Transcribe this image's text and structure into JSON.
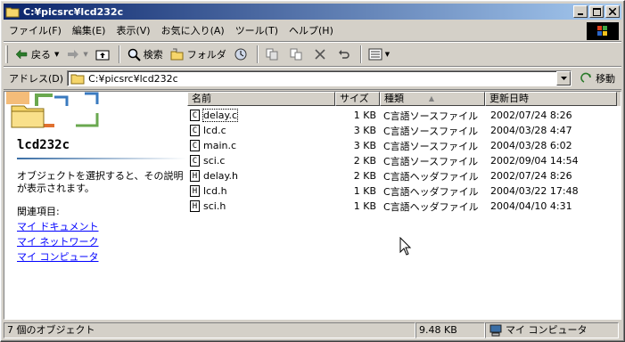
{
  "window": {
    "title": "C:¥picsrc¥lcd232c",
    "minimize": "_",
    "maximize": "□",
    "close": "✕"
  },
  "menu": [
    "ファイル(F)",
    "編集(E)",
    "表示(V)",
    "お気に入り(A)",
    "ツール(T)",
    "ヘルプ(H)"
  ],
  "toolbar": {
    "back": "戻る",
    "search": "検索",
    "folders": "フォルダ"
  },
  "address": {
    "label": "アドレス(D)",
    "path": "C:¥picsrc¥lcd232c",
    "go": "移動"
  },
  "leftpane": {
    "folder_name": "lcd232c",
    "description": "オブジェクトを選択すると、その説明が表示されます。",
    "related_label": "関連項目:",
    "links": [
      "マイ ドキュメント",
      "マイ ネットワーク",
      "マイ コンピュータ"
    ]
  },
  "columns": {
    "name": "名前",
    "size": "サイズ",
    "type": "種類",
    "sort_indicator": "▲",
    "date": "更新日時"
  },
  "files": [
    {
      "icon": "c-file-icon",
      "glyph": "C",
      "name": "delay.c",
      "size": "1 KB",
      "type": "C言語ソースファイル",
      "date": "2002/07/24 8:26"
    },
    {
      "icon": "c-file-icon",
      "glyph": "C",
      "name": "lcd.c",
      "size": "3 KB",
      "type": "C言語ソースファイル",
      "date": "2004/03/28 4:47"
    },
    {
      "icon": "c-file-icon",
      "glyph": "C",
      "name": "main.c",
      "size": "3 KB",
      "type": "C言語ソースファイル",
      "date": "2004/03/28 6:02"
    },
    {
      "icon": "c-file-icon",
      "glyph": "C",
      "name": "sci.c",
      "size": "2 KB",
      "type": "C言語ソースファイル",
      "date": "2002/09/04 14:54"
    },
    {
      "icon": "h-file-icon",
      "glyph": "H",
      "name": "delay.h",
      "size": "2 KB",
      "type": "C言語ヘッダファイル",
      "date": "2002/07/24 8:26"
    },
    {
      "icon": "h-file-icon",
      "glyph": "H",
      "name": "lcd.h",
      "size": "1 KB",
      "type": "C言語ヘッダファイル",
      "date": "2004/03/22 17:48"
    },
    {
      "icon": "h-file-icon",
      "glyph": "H",
      "name": "sci.h",
      "size": "1 KB",
      "type": "C言語ヘッダファイル",
      "date": "2004/04/10 4:31"
    }
  ],
  "status": {
    "count": "7 個のオブジェクト",
    "size": "9.48 KB",
    "zone": "マイ コンピュータ"
  },
  "colors": {
    "title_start": "#0a246a",
    "title_end": "#a6caf0",
    "face": "#d4d0c8",
    "link": "#0000ff"
  }
}
